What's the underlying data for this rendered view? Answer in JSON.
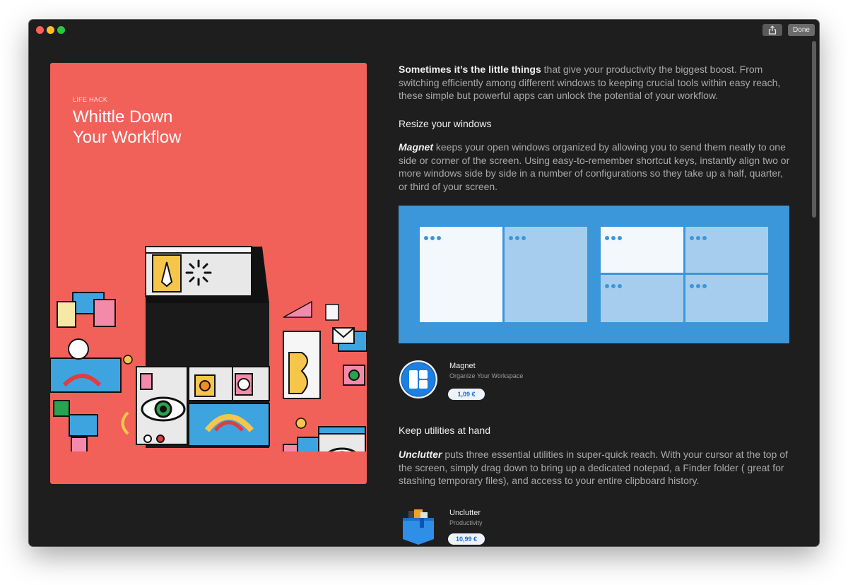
{
  "window": {
    "share_label": "",
    "done_label": "Done"
  },
  "hero": {
    "eyebrow": "LIFE HACK",
    "title_line1": "Whittle Down",
    "title_line2": "Your Workflow"
  },
  "article": {
    "intro_bold": "Sometimes it’s the little things",
    "intro_rest": " that give your productivity the biggest boost. From switching efficiently among different windows to keeping crucial tools within easy reach, these simple but powerful apps can unlock the potential of your workflow.",
    "section1": {
      "heading": "Resize your windows",
      "app_word": "Magnet",
      "body": " keeps your open windows organized by allowing you to send them neatly to one side or corner of the screen. Using easy-to-remember shortcut keys, instantly align two or more windows side by side in a number of configurations so they take up a half, quarter, or third of your screen."
    },
    "magnet_app": {
      "name": "Magnet",
      "subtitle": "Organize Your Workspace",
      "price": "1,09 €"
    },
    "section2": {
      "heading": "Keep utilities at hand",
      "app_word": "Unclutter",
      "body": " puts three essential utilities in super-quick reach. With your cursor at the top of the screen, simply drag down to bring up a dedicated notepad, a Finder folder ( great for stashing temporary files), and access to your entire clipboard history."
    },
    "unclutter_app": {
      "name": "Unclutter",
      "subtitle": "Productivity",
      "price": "10,99 €"
    }
  },
  "colors": {
    "hero_bg": "#f1615a",
    "window_bg": "#1e1e1e",
    "diagram_bg": "#3b97d9",
    "price_text": "#1b6cd8"
  },
  "icons": [
    "share-icon",
    "magnet-app-icon",
    "unclutter-app-icon"
  ]
}
